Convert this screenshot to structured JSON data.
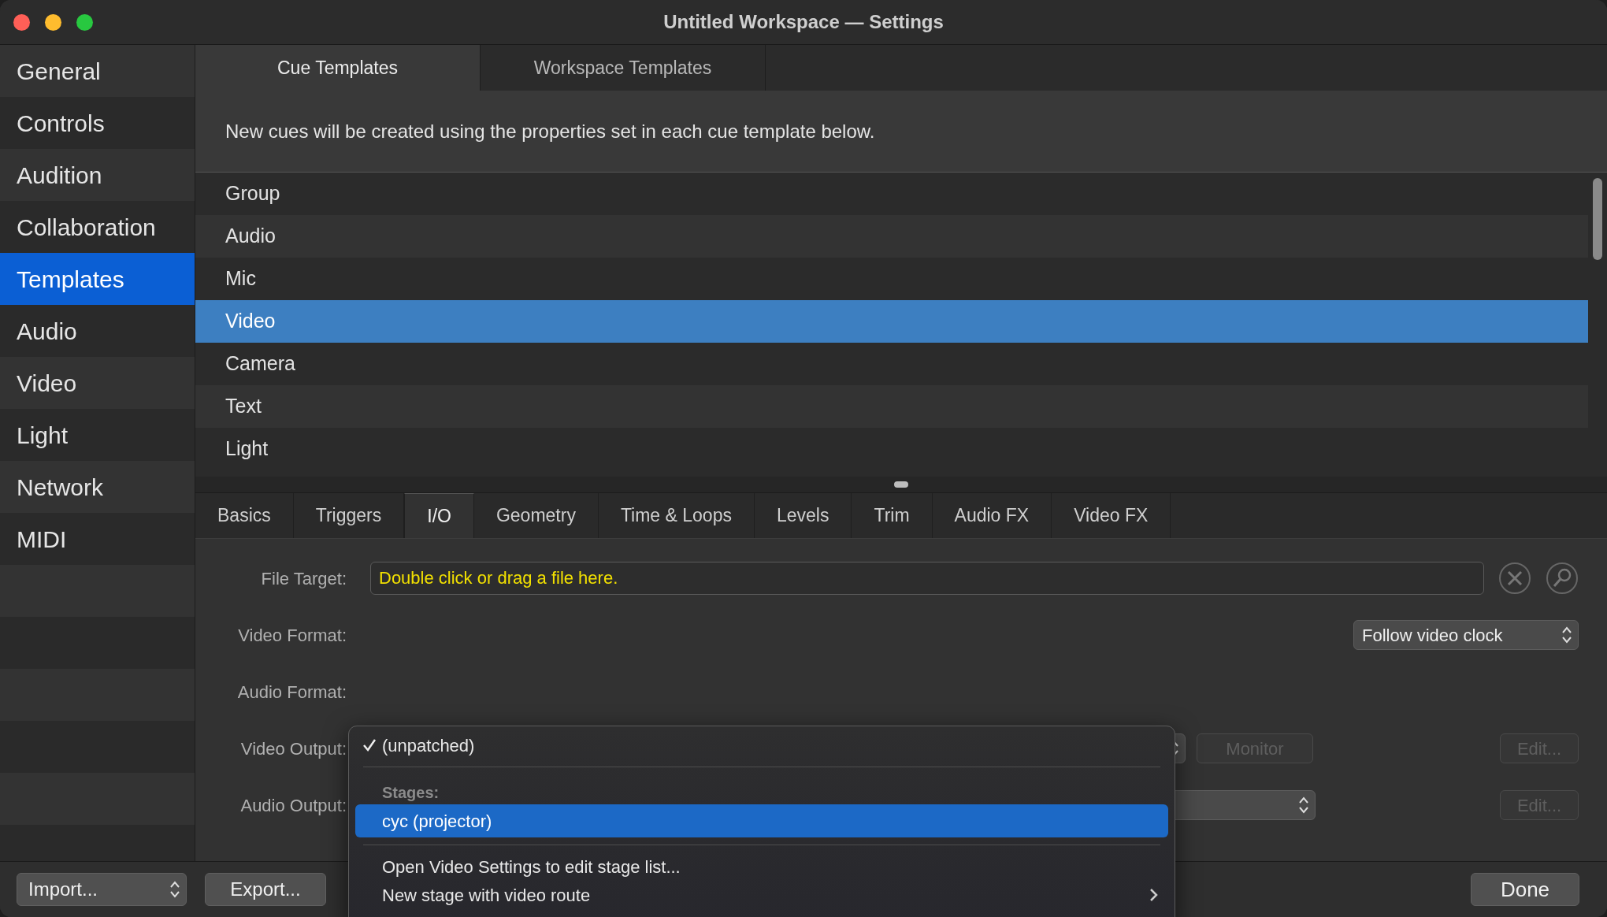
{
  "window": {
    "title": "Untitled Workspace — Settings"
  },
  "sidebar": {
    "items": [
      {
        "label": "General",
        "selected": false
      },
      {
        "label": "Controls",
        "selected": false
      },
      {
        "label": "Audition",
        "selected": false
      },
      {
        "label": "Collaboration",
        "selected": false
      },
      {
        "label": "Templates",
        "selected": true
      },
      {
        "label": "Audio",
        "selected": false
      },
      {
        "label": "Video",
        "selected": false
      },
      {
        "label": "Light",
        "selected": false
      },
      {
        "label": "Network",
        "selected": false
      },
      {
        "label": "MIDI",
        "selected": false
      }
    ]
  },
  "template_tabs": [
    {
      "label": "Cue Templates",
      "selected": true
    },
    {
      "label": "Workspace Templates",
      "selected": false
    }
  ],
  "description": "New cues will be created using the properties set in each cue template below.",
  "cue_templates": [
    {
      "label": "Group",
      "selected": false
    },
    {
      "label": "Audio",
      "selected": false
    },
    {
      "label": "Mic",
      "selected": false
    },
    {
      "label": "Video",
      "selected": true
    },
    {
      "label": "Camera",
      "selected": false
    },
    {
      "label": "Text",
      "selected": false
    },
    {
      "label": "Light",
      "selected": false
    }
  ],
  "property_tabs": [
    {
      "label": "Basics",
      "selected": false
    },
    {
      "label": "Triggers",
      "selected": false
    },
    {
      "label": "I/O",
      "selected": true
    },
    {
      "label": "Geometry",
      "selected": false
    },
    {
      "label": "Time & Loops",
      "selected": false
    },
    {
      "label": "Levels",
      "selected": false
    },
    {
      "label": "Trim",
      "selected": false
    },
    {
      "label": "Audio FX",
      "selected": false
    },
    {
      "label": "Video FX",
      "selected": false
    }
  ],
  "form": {
    "file_target": {
      "label": "File Target:",
      "placeholder": "Double click or drag a file here."
    },
    "video_format": {
      "label": "Video Format:",
      "value": "Follow video clock"
    },
    "audio_format": {
      "label": "Audio Format:"
    },
    "video_output": {
      "label": "Video Output:",
      "monitor_button": {
        "label": "Monitor",
        "disabled": true
      },
      "edit_button": {
        "label": "Edit...",
        "disabled": true
      }
    },
    "audio_output": {
      "label": "Audio Output:",
      "edit_button": {
        "label": "Edit...",
        "disabled": true
      }
    }
  },
  "menu": {
    "items": [
      {
        "kind": "item",
        "label": "(unpatched)",
        "checked": true,
        "selected": false
      },
      {
        "kind": "separator"
      },
      {
        "kind": "header",
        "label": "Stages:"
      },
      {
        "kind": "item",
        "label": "cyc (projector)",
        "checked": false,
        "selected": true
      },
      {
        "kind": "separator"
      },
      {
        "kind": "item",
        "label": "Open Video Settings to edit stage list...",
        "checked": false,
        "selected": false
      },
      {
        "kind": "item",
        "label": "New stage with video route",
        "checked": false,
        "selected": false,
        "submenu": true
      }
    ]
  },
  "footer": {
    "import_button": "Import...",
    "export_button": "Export...",
    "done_button": "Done"
  }
}
